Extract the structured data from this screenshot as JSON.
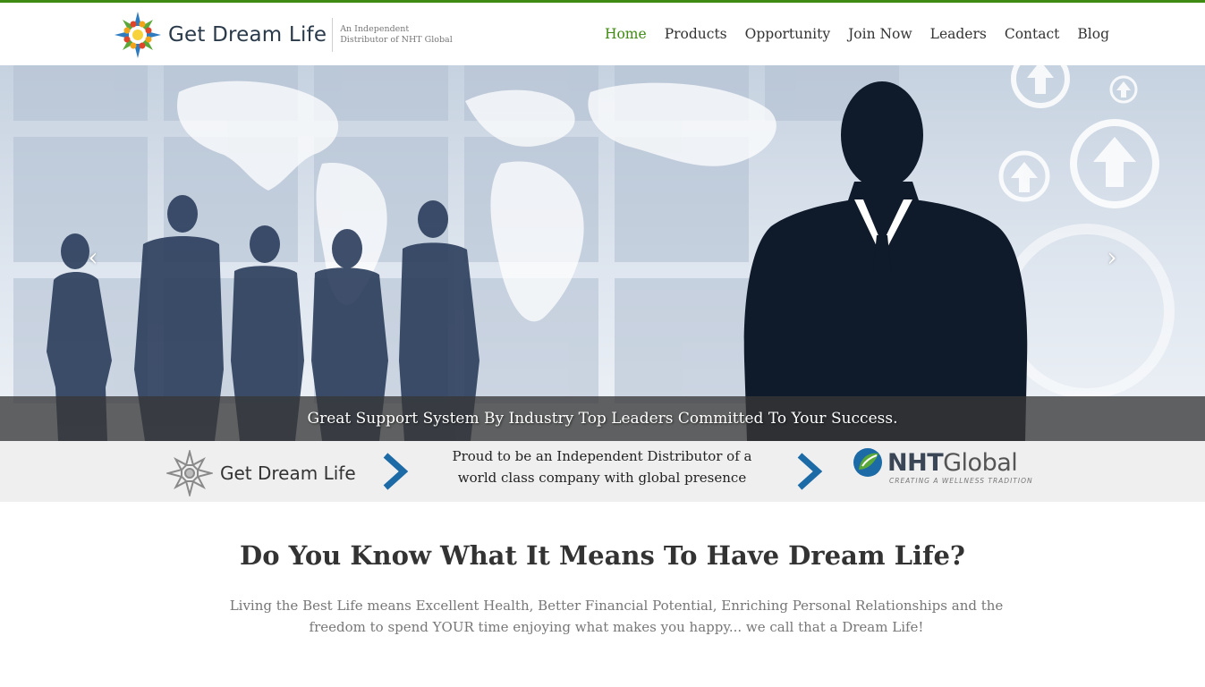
{
  "header": {
    "brand_name": "Get Dream Life",
    "tagline_line1": "An Independent",
    "tagline_line2": "Distributor of NHT Global",
    "nav": [
      {
        "label": "Home",
        "active": true
      },
      {
        "label": "Products",
        "active": false
      },
      {
        "label": "Opportunity",
        "active": false
      },
      {
        "label": "Join Now",
        "active": false
      },
      {
        "label": "Leaders",
        "active": false
      },
      {
        "label": "Contact",
        "active": false
      },
      {
        "label": "Blog",
        "active": false
      }
    ]
  },
  "hero": {
    "caption": "Great Support System By Industry Top Leaders Committed To Your Success.",
    "prev_icon": "chevron-left-icon",
    "next_icon": "chevron-right-icon"
  },
  "strip": {
    "brand_name": "Get Dream Life",
    "text": "Proud to be an Independent Distributor of a world class company with global presence",
    "partner_name_bold": "NHT",
    "partner_name_light": "Global",
    "partner_tagline": "CREATING A WELLNESS TRADITION"
  },
  "main": {
    "title": "Do You Know What It Means To Have Dream Life?",
    "text": "Living the Best Life means Excellent Health, Better Financial Potential, Enriching Personal Relationships and the freedom to spend YOUR time enjoying what makes you happy... we call that a Dream Life!"
  },
  "colors": {
    "accent_green": "#3f8a12",
    "chevron_blue": "#1c6aa6",
    "caption_bar": "#373737"
  }
}
